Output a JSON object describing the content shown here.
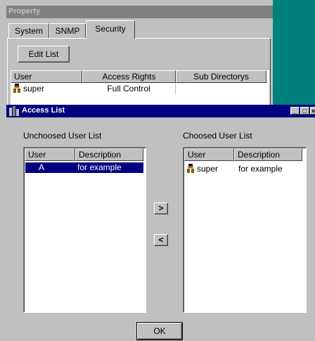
{
  "property_window": {
    "title": "Property",
    "tabs": [
      {
        "label": "System"
      },
      {
        "label": "SNMP"
      },
      {
        "label": "Security"
      }
    ],
    "edit_list_label": "Edit List",
    "table": {
      "headers": [
        "User",
        "Access Rights",
        "Sub Directorys"
      ],
      "rows": [
        {
          "user": "super",
          "access": "Full Control",
          "sub": ""
        }
      ]
    }
  },
  "access_dialog": {
    "title": "Access List",
    "controls": {
      "minimize": "_",
      "maximize": "□",
      "close": "×"
    },
    "unchoosed": {
      "label": "Unchoosed User List",
      "headers": [
        "User",
        "Description"
      ],
      "rows": [
        {
          "user": "A",
          "description": "for example",
          "selected": true
        }
      ]
    },
    "choosed": {
      "label": "Choosed User List",
      "headers": [
        "User",
        "Description"
      ],
      "rows": [
        {
          "user": "super",
          "description": "for example"
        }
      ]
    },
    "move_right_label": ">",
    "move_left_label": "<",
    "ok_label": "OK"
  },
  "colors": {
    "desktop": "#007f7f",
    "active_title": "#000080",
    "inactive_title": "#808080",
    "face": "#c0c0c0"
  }
}
